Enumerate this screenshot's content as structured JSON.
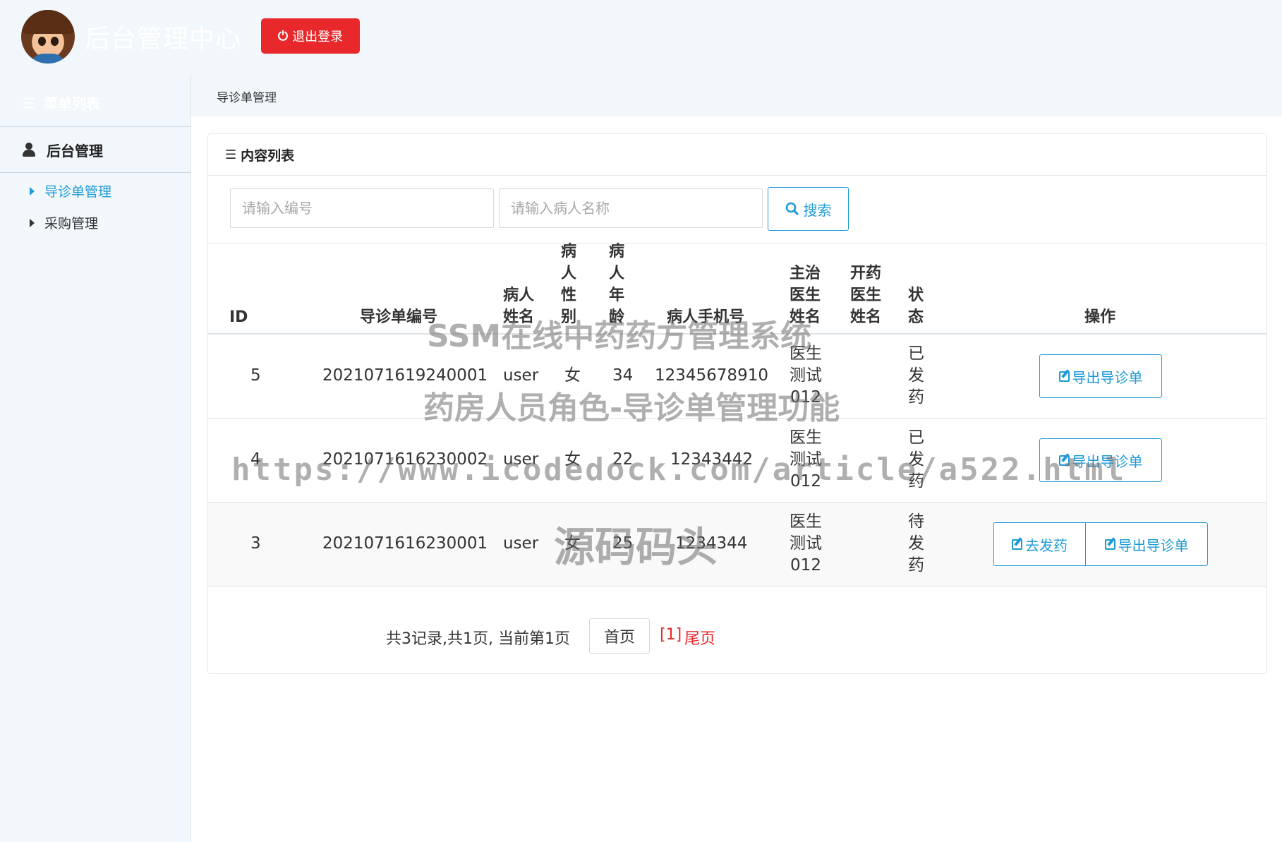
{
  "header": {
    "app_title": "后台管理中心",
    "logout_label": "退出登录"
  },
  "sidebar": {
    "menu_title": "菜单列表",
    "group_label": "后台管理",
    "items": [
      {
        "label": "导诊单管理",
        "active": true
      },
      {
        "label": "采购管理",
        "active": false
      }
    ]
  },
  "breadcrumb": "导诊单管理",
  "panel": {
    "title": "内容列表",
    "search": {
      "code_placeholder": "请输入编号",
      "name_placeholder": "请输入病人名称",
      "button_label": "搜索"
    },
    "table": {
      "headers": {
        "id": "ID",
        "code": "导诊单编号",
        "name": [
          "病人",
          "姓名"
        ],
        "sex": [
          "病",
          "人",
          "性",
          "别"
        ],
        "age": [
          "病",
          "人",
          "年",
          "龄"
        ],
        "phone": "病人手机号",
        "doctor": [
          "主治",
          "医生",
          "姓名"
        ],
        "prescriber": [
          "开药",
          "医生",
          "姓名"
        ],
        "status": [
          "状",
          "态"
        ],
        "ops": "操作"
      },
      "rows": [
        {
          "id": "5",
          "code": "202107161924000​1",
          "name": "user",
          "sex": "女",
          "age": "34",
          "phone": "12345678910",
          "doctor": [
            "医生",
            "测试",
            "012"
          ],
          "status": [
            "已",
            "发",
            "药"
          ],
          "actions": [
            "导出导诊单"
          ]
        },
        {
          "id": "4",
          "code": "2021071616230002",
          "name": "user",
          "sex": "女",
          "age": "22",
          "phone": "12343442",
          "doctor": [
            "医生",
            "测试",
            "012"
          ],
          "status": [
            "已",
            "发",
            "药"
          ],
          "actions": [
            "导出导诊单"
          ]
        },
        {
          "id": "3",
          "code": "2021071616230001",
          "name": "user",
          "sex": "女",
          "age": "25",
          "phone": "1234344",
          "doctor": [
            "医生",
            "测试",
            "012"
          ],
          "status": [
            "待",
            "发",
            "药"
          ],
          "actions": [
            "去发药",
            "导出导诊单"
          ]
        }
      ]
    },
    "pagination": {
      "summary": "共3记录,共1页, 当前第1页",
      "first_label": "首页",
      "current_label": "[1]",
      "last_label": "尾页"
    }
  },
  "watermark": {
    "line1": "SSM在线中药药方管理系统",
    "line2": "药房人员角色-导诊单管理功能",
    "line3": "https://www.icodedock.com/article/a522.html",
    "line4": "源码码头"
  },
  "colors": {
    "accent": "#1d9ad6",
    "danger": "#e8282b",
    "background": "#f1f7fb"
  }
}
